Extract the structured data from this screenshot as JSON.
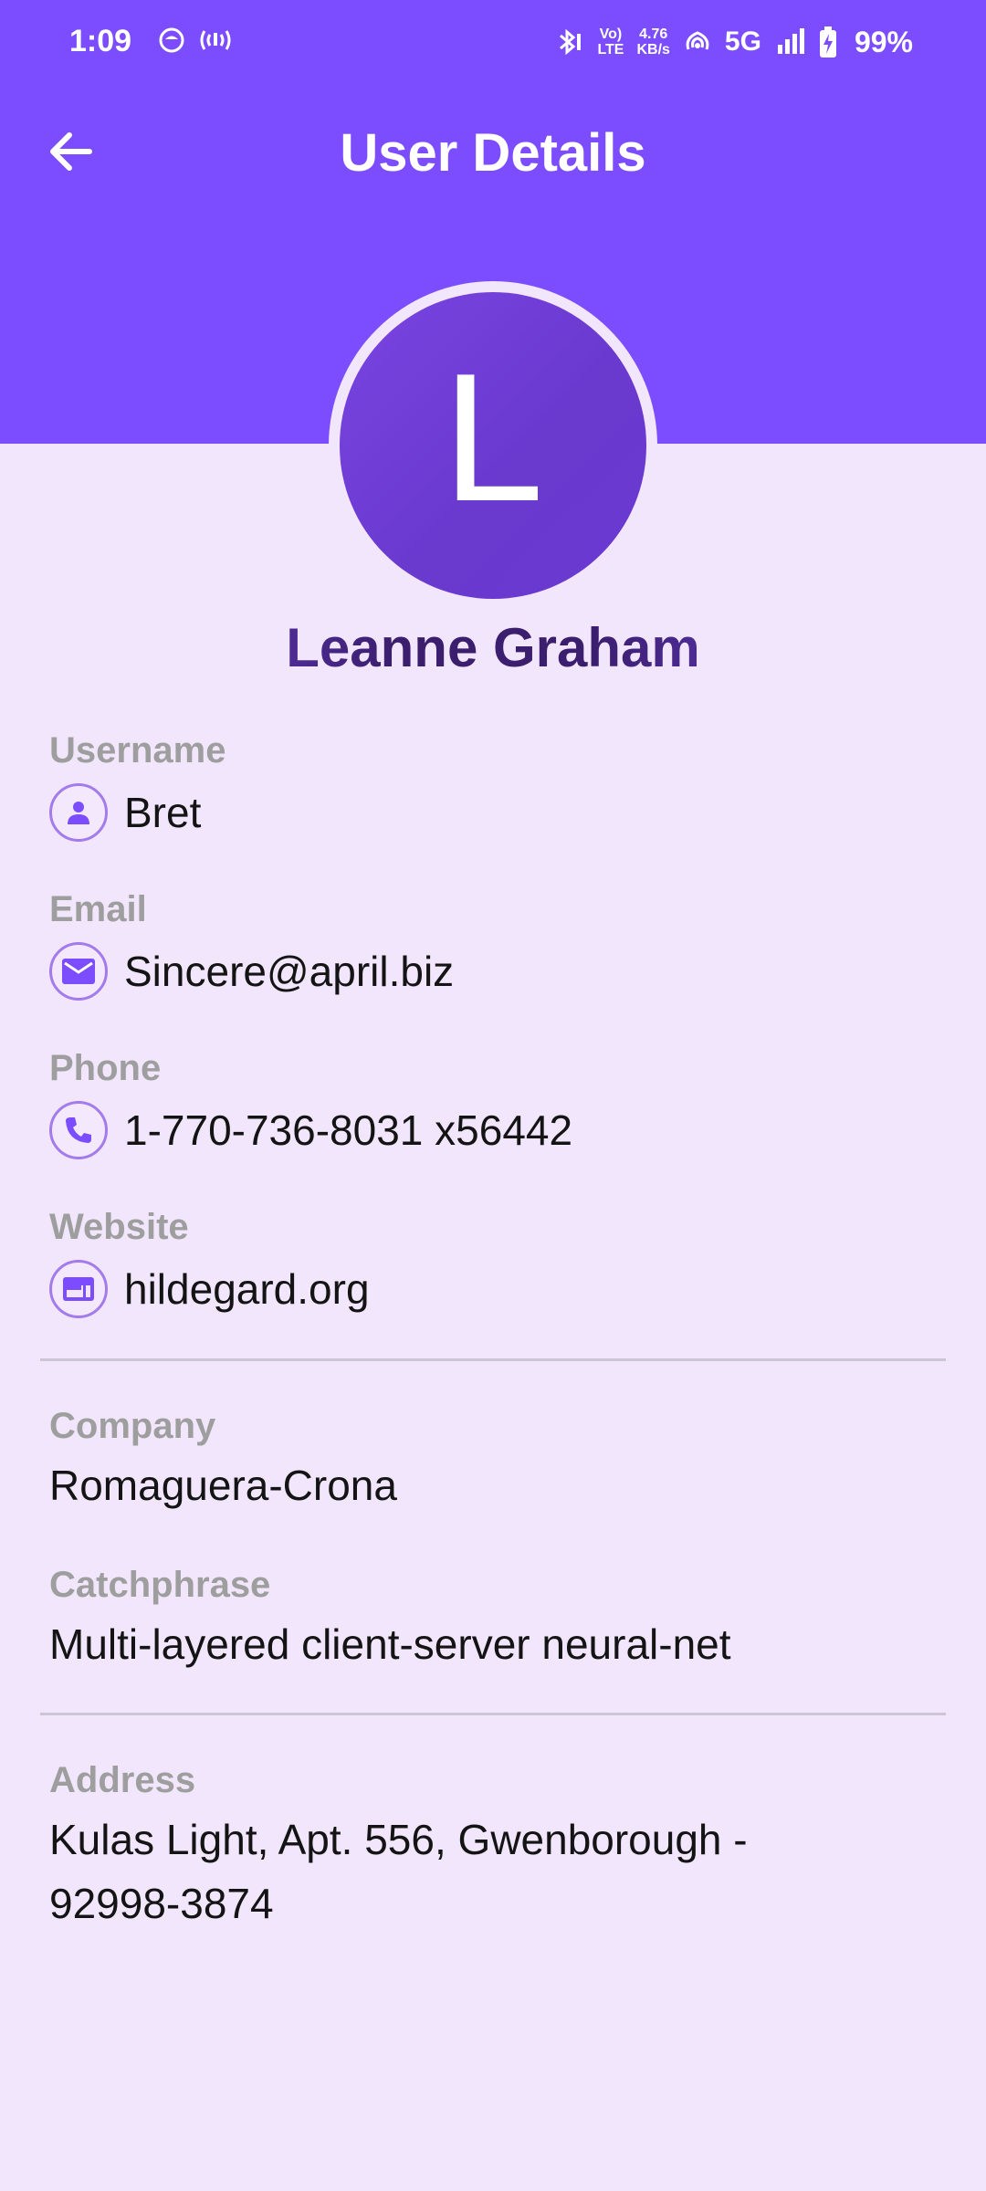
{
  "status_bar": {
    "time": "1:09",
    "net_speed_top": "4.76",
    "net_speed_bottom": "KB/s",
    "volte_top": "Vo)",
    "volte_bottom": "LTE",
    "network": "5G",
    "battery": "99%"
  },
  "app_bar": {
    "title": "User Details",
    "back_icon": "arrow-left-icon"
  },
  "profile": {
    "avatar_initial": "L",
    "name": "Leanne Graham"
  },
  "contact": {
    "username": {
      "label": "Username",
      "value": "Bret",
      "icon": "person-icon"
    },
    "email": {
      "label": "Email",
      "value": "Sincere@april.biz",
      "icon": "mail-icon"
    },
    "phone": {
      "label": "Phone",
      "value": "1-770-736-8031 x56442",
      "icon": "phone-icon"
    },
    "website": {
      "label": "Website",
      "value": "hildegard.org",
      "icon": "web-icon"
    }
  },
  "company": {
    "name_label": "Company",
    "name_value": "Romaguera-Crona",
    "catchphrase_label": "Catchphrase",
    "catchphrase_value": "Multi-layered client-server neural-net"
  },
  "address": {
    "label": "Address",
    "value": "Kulas Light, Apt. 556, Gwenborough - 92998-3874"
  },
  "colors": {
    "primary": "#7C4DFF",
    "avatar": "#6A3ACF",
    "background": "#F2E6FC",
    "label": "#9E9E9E"
  }
}
